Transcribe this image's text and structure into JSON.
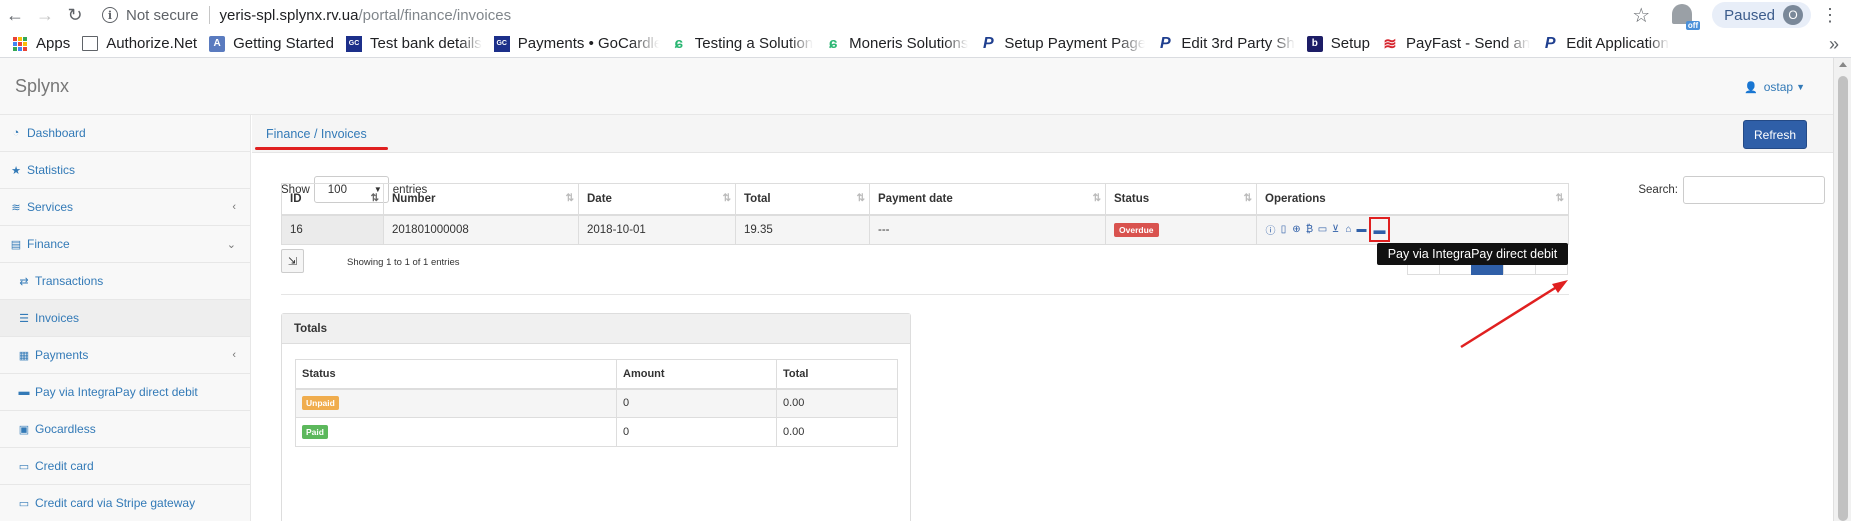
{
  "browser": {
    "not_secure": "Not secure",
    "url_host": "yeris-spl.splynx.rv.ua",
    "url_path": "/portal/finance/invoices",
    "ext_badge": "off",
    "paused_label": "Paused",
    "profile_initial": "O"
  },
  "bookmarks": [
    {
      "label": "Apps",
      "icon": "apps-grid-icon"
    },
    {
      "label": "Authorize.Net",
      "icon": "authorize-net-favicon"
    },
    {
      "label": "Getting Started",
      "icon": "getting-started-favicon"
    },
    {
      "label": "Test bank details",
      "icon": "gocardless-favicon"
    },
    {
      "label": "Payments • GoCardless",
      "icon": "gocardless-favicon"
    },
    {
      "label": "Testing a Solution",
      "icon": "moneris-favicon"
    },
    {
      "label": "Moneris Solutions",
      "icon": "moneris-favicon"
    },
    {
      "label": "Setup Payment Page",
      "icon": "paypal-favicon"
    },
    {
      "label": "Edit 3rd Party Sh",
      "icon": "paypal-favicon"
    },
    {
      "label": "Setup",
      "icon": "b-favicon"
    },
    {
      "label": "PayFast - Send an",
      "icon": "payfast-favicon"
    },
    {
      "label": "Edit Application",
      "icon": "paypal-favicon"
    }
  ],
  "app": {
    "brand": "Splynx",
    "user": "ostap"
  },
  "sidebar": {
    "items": [
      {
        "label": "Dashboard",
        "icon": "dashboard-icon"
      },
      {
        "label": "Statistics",
        "icon": "star-icon"
      },
      {
        "label": "Services",
        "icon": "wifi-icon",
        "chevron": "‹"
      },
      {
        "label": "Finance",
        "icon": "finance-icon",
        "chevron": "⌄"
      },
      {
        "label": "Transactions",
        "icon": "transactions-icon"
      },
      {
        "label": "Invoices",
        "icon": "list-icon"
      },
      {
        "label": "Payments",
        "icon": "payments-icon",
        "chevron": "‹"
      },
      {
        "label": "Pay via IntegraPay direct debit",
        "icon": "card-icon"
      },
      {
        "label": "Gocardless",
        "icon": "id-card-icon"
      },
      {
        "label": "Credit card",
        "icon": "credit-card-icon"
      },
      {
        "label": "Credit card via Stripe gateway",
        "icon": "credit-card-icon"
      }
    ]
  },
  "page": {
    "breadcrumb": "Finance / Invoices",
    "refresh_label": "Refresh",
    "show_label": "Show",
    "page_length": "100",
    "entries_label": "entries",
    "search_label": "Search:",
    "showing_text": "Showing 1 to 1 of 1 entries",
    "tooltip": "Pay via IntegraPay direct debit"
  },
  "invoices": {
    "columns": [
      "ID",
      "Number",
      "Date",
      "Total",
      "Payment date",
      "Status",
      "Operations"
    ],
    "rows": [
      {
        "id": "16",
        "number": "201801000008",
        "date": "2018-10-01",
        "total": "19.35",
        "payment_date": "---",
        "status": "Overdue"
      }
    ],
    "operations_icons": [
      "info-icon",
      "file-icon",
      "download-icon",
      "bitcoin-icon",
      "credit-card-icon",
      "cart-icon",
      "bank-icon",
      "card-icon",
      "integrapay-direct-debit-icon"
    ]
  },
  "totals": {
    "title": "Totals",
    "columns": [
      "Status",
      "Amount",
      "Total"
    ],
    "rows": [
      {
        "status": "Unpaid",
        "amount": "0",
        "total": "0.00",
        "color": "#f0ad4e"
      },
      {
        "status": "Paid",
        "amount": "0",
        "total": "0.00",
        "color": "#5cb85c"
      }
    ]
  },
  "colors": {
    "link": "#337ab7",
    "primary": "#2f5fa8",
    "overdue": "#d9534f",
    "annotation_red": "#e02020"
  }
}
